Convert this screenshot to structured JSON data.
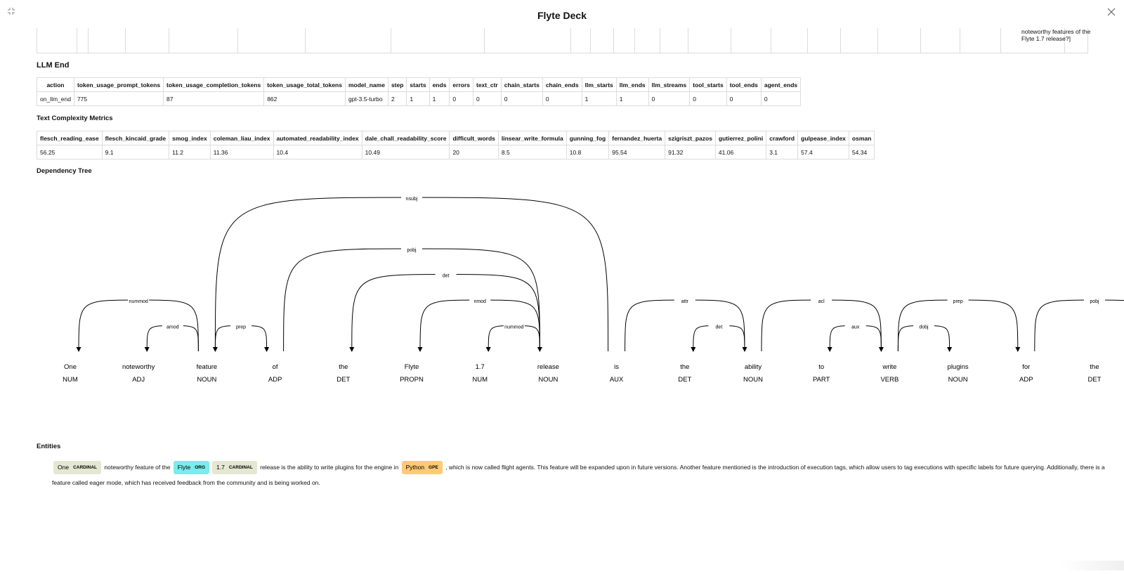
{
  "window": {
    "title": "Flyte Deck"
  },
  "top_table": {
    "partial_cell_text": "noteworthy features of the Flyte 1.7 release?]"
  },
  "llm_end": {
    "title": "LLM End",
    "columns": [
      "action",
      "token_usage_prompt_tokens",
      "token_usage_completion_tokens",
      "token_usage_total_tokens",
      "model_name",
      "step",
      "starts",
      "ends",
      "errors",
      "text_ctr",
      "chain_starts",
      "chain_ends",
      "llm_starts",
      "llm_ends",
      "llm_streams",
      "tool_starts",
      "tool_ends",
      "agent_ends"
    ],
    "row": [
      "on_llm_end",
      "775",
      "87",
      "862",
      "gpt-3.5-turbo",
      "2",
      "1",
      "1",
      "0",
      "0",
      "0",
      "0",
      "1",
      "1",
      "0",
      "0",
      "0",
      "0"
    ]
  },
  "text_complexity": {
    "title": "Text Complexity Metrics",
    "columns": [
      "flesch_reading_ease",
      "flesch_kincaid_grade",
      "smog_index",
      "coleman_liau_index",
      "automated_readability_index",
      "dale_chall_readability_score",
      "difficult_words",
      "linsear_write_formula",
      "gunning_fog",
      "fernandez_huerta",
      "szigriszt_pazos",
      "gutierrez_polini",
      "crawford",
      "gulpease_index",
      "osman"
    ],
    "row": [
      "56.25",
      "9.1",
      "11.2",
      "11.36",
      "10.4",
      "10.49",
      "20",
      "8.5",
      "10.8",
      "95.54",
      "91.32",
      "41.06",
      "3.1",
      "57.4",
      "54.34"
    ]
  },
  "dependency_tree": {
    "title": "Dependency Tree",
    "tokens": [
      {
        "text": "One",
        "tag": "NUM"
      },
      {
        "text": "noteworthy",
        "tag": "ADJ"
      },
      {
        "text": "feature",
        "tag": "NOUN"
      },
      {
        "text": "of",
        "tag": "ADP"
      },
      {
        "text": "the",
        "tag": "DET"
      },
      {
        "text": "Flyte",
        "tag": "PROPN"
      },
      {
        "text": "1.7",
        "tag": "NUM"
      },
      {
        "text": "release",
        "tag": "NOUN"
      },
      {
        "text": "is",
        "tag": "AUX"
      },
      {
        "text": "the",
        "tag": "DET"
      },
      {
        "text": "ability",
        "tag": "NOUN"
      },
      {
        "text": "to",
        "tag": "PART"
      },
      {
        "text": "write",
        "tag": "VERB"
      },
      {
        "text": "plugins",
        "tag": "NOUN"
      },
      {
        "text": "for",
        "tag": "ADP"
      },
      {
        "text": "the",
        "tag": "DET"
      },
      {
        "text": "",
        "tag": ""
      }
    ],
    "arcs": [
      {
        "from": 2,
        "to": 0,
        "label": "nummod"
      },
      {
        "from": 2,
        "to": 1,
        "label": "amod"
      },
      {
        "from": 2,
        "to": 3,
        "label": "prep"
      },
      {
        "from": 7,
        "to": 4,
        "label": "det"
      },
      {
        "from": 7,
        "to": 5,
        "label": "nmod"
      },
      {
        "from": 7,
        "to": 6,
        "label": "nummod"
      },
      {
        "from": 3,
        "to": 7,
        "label": "pobj"
      },
      {
        "from": 8,
        "to": 2,
        "label": "nsubj"
      },
      {
        "from": 10,
        "to": 9,
        "label": "det"
      },
      {
        "from": 8,
        "to": 10,
        "label": "attr"
      },
      {
        "from": 12,
        "to": 11,
        "label": "aux"
      },
      {
        "from": 10,
        "to": 12,
        "label": "acl"
      },
      {
        "from": 12,
        "to": 13,
        "label": "dobj"
      },
      {
        "from": 12,
        "to": 14,
        "label": "prep"
      },
      {
        "from": 14,
        "to": 16,
        "label": "pobj"
      }
    ]
  },
  "entities": {
    "title": "Entities",
    "parts": [
      {
        "type": "ent",
        "text": "One",
        "label": "CARDINAL",
        "color": "#e4e7d2"
      },
      {
        "type": "text",
        "text": "noteworthy feature of the"
      },
      {
        "type": "ent",
        "text": "Flyte",
        "label": "ORG",
        "color": "#7aecec"
      },
      {
        "type": "ent",
        "text": "1.7",
        "label": "CARDINAL",
        "color": "#e4e7d2"
      },
      {
        "type": "text",
        "text": "release is the ability to write plugins for the engine in"
      },
      {
        "type": "ent",
        "text": "Python",
        "label": "GPE",
        "color": "#feca74"
      },
      {
        "type": "text",
        "text": ", which is now called flight agents. This feature will be expanded upon in future versions. Another feature mentioned is the introduction of execution tags, which allow users to tag executions with specific labels for future querying. Additionally, there is a feature called eager mode, which has received feedback from the community and is being worked on."
      }
    ]
  },
  "icons": {
    "left": "shrink-icon",
    "right": "close-icon"
  }
}
